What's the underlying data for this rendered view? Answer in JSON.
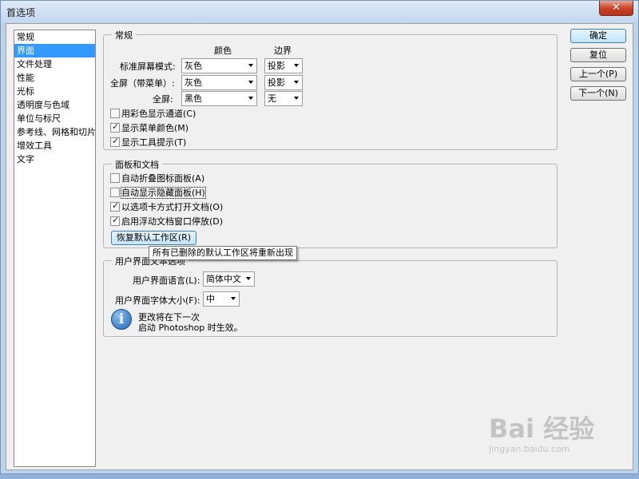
{
  "window": {
    "title": "首选项",
    "close_glyph": "✕"
  },
  "sidebar": {
    "items": [
      {
        "label": "常规",
        "selected": false
      },
      {
        "label": "界面",
        "selected": true
      },
      {
        "label": "文件处理",
        "selected": false
      },
      {
        "label": "性能",
        "selected": false
      },
      {
        "label": "光标",
        "selected": false
      },
      {
        "label": "透明度与色域",
        "selected": false
      },
      {
        "label": "单位与标尺",
        "selected": false
      },
      {
        "label": "参考线、网格和切片",
        "selected": false
      },
      {
        "label": "增效工具",
        "selected": false
      },
      {
        "label": "文字",
        "selected": false
      }
    ]
  },
  "general": {
    "title": "常规",
    "col_color": "颜色",
    "col_border": "边界",
    "rows": [
      {
        "label": "标准屏幕模式:",
        "color": "灰色",
        "border": "投影"
      },
      {
        "label": "全屏（带菜单）:",
        "color": "灰色",
        "border": "投影"
      },
      {
        "label": "全屏:",
        "color": "黑色",
        "border": "无"
      }
    ],
    "checks": [
      {
        "label": "用彩色显示通道(C)",
        "checked": false
      },
      {
        "label": "显示菜单颜色(M)",
        "checked": true
      },
      {
        "label": "显示工具提示(T)",
        "checked": true
      }
    ]
  },
  "panels": {
    "title": "面板和文档",
    "checks": [
      {
        "label": "自动折叠图标面板(A)",
        "checked": false
      },
      {
        "label": "自动显示隐藏面板(H)",
        "checked": false
      },
      {
        "label": "以选项卡方式打开文档(O)",
        "checked": true
      },
      {
        "label": "启用浮动文档窗口停放(D)",
        "checked": true
      }
    ],
    "restore_button": "恢复默认工作区(R)",
    "tooltip": "所有已删除的默认工作区将重新出现"
  },
  "ui_text": {
    "title": "用户界面文本选项",
    "language_label": "用户界面语言(L):",
    "language_value": "简体中文",
    "fontsize_label": "用户界面字体大小(F):",
    "fontsize_value": "中",
    "note_line1": "更改将在下一次",
    "note_line2": "启动 Photoshop 时生效。"
  },
  "buttons": {
    "ok": "确定",
    "reset": "复位",
    "prev": "上一个(P)",
    "next": "下一个(N)"
  },
  "watermark": {
    "logo": "Bai 经验",
    "url": "jingyan.baidu.com"
  },
  "icons": {
    "info": "info-icon",
    "check": "checkmark-icon",
    "dropdown": "chevron-down-icon"
  }
}
